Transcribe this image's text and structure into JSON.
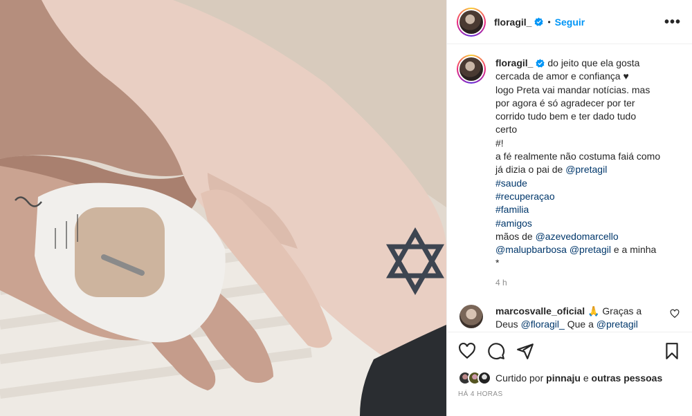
{
  "post": {
    "username": "floragil_",
    "follow_label": "Seguir",
    "dot": "•",
    "more": "•••"
  },
  "caption": {
    "username": "floragil_",
    "lines": [
      "do jeito que ela gosta",
      "cercada de amor e confiança ♥",
      "logo Preta vai mandar notícias. mas",
      "por agora é só agradecer por ter",
      "corrido tudo bem e ter dado tudo",
      "certo",
      "#!",
      "a fé realmente não costuma faiá como",
      "já dizia o pai de "
    ],
    "mention_pai": "@pretagil",
    "hashtags": [
      "#saude",
      "#recuperaçao",
      "#familia",
      "#amigos"
    ],
    "maos_de": "mãos de ",
    "mention_1": "@azevedomarcello",
    "mention_2": "@malupbarbosa",
    "mention_3": "@pretagil",
    "tail": " e a minha",
    "star": "*",
    "time": "4 h"
  },
  "comment": {
    "username": "marcosvalle_oficial",
    "emoji": "🙏",
    "text_1": " Graças a",
    "text_2": "Deus ",
    "mention_1": "@floragil_",
    "text_3": " Que a ",
    "mention_2": "@pretagil"
  },
  "likes": {
    "prefix": "Curtido por ",
    "user": "pinnaju",
    "middle": " e ",
    "others": "outras pessoas"
  },
  "posted_ago": "HÁ 4 HORAS",
  "colors": {
    "accent": "#0095f6",
    "link": "#00376b",
    "muted": "#8e8e8e",
    "text": "#262626"
  }
}
